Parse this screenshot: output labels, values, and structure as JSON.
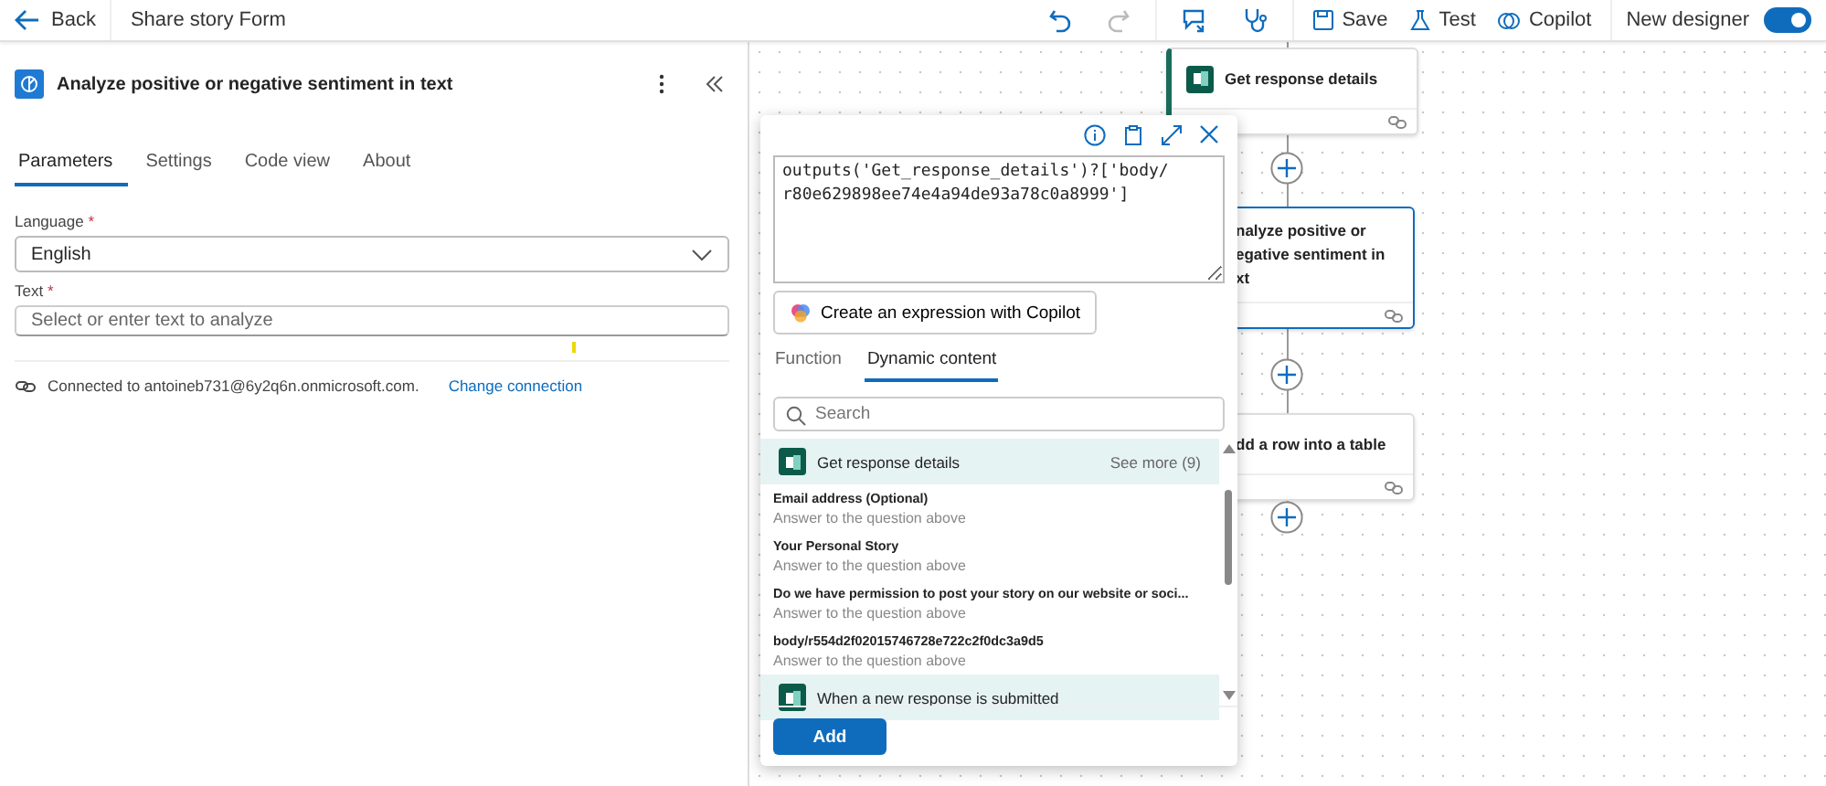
{
  "top_bar": {
    "back": "Back",
    "title": "Share story Form",
    "actions": [
      {
        "kind": "save",
        "label": "Save"
      },
      {
        "kind": "test",
        "label": "Test"
      },
      {
        "kind": "copilot",
        "label": "Copilot"
      }
    ],
    "toggle": {
      "label": "New designer",
      "on": true
    }
  },
  "panel": {
    "title": "Analyze positive or negative sentiment in text",
    "tabs": [
      {
        "label": "Parameters",
        "selected": true
      },
      {
        "label": "Settings",
        "selected": false
      },
      {
        "label": "Code view",
        "selected": false
      },
      {
        "label": "About",
        "selected": false
      }
    ],
    "language": {
      "label": "Language",
      "required": "*",
      "value": "English"
    },
    "text": {
      "label": "Text",
      "required": "*",
      "placeholder": "Select or enter text to analyze"
    },
    "connection": {
      "text": "Connected to antoineb731@6y2q6n.onmicrosoft.com.",
      "link": "Change connection"
    }
  },
  "flow": {
    "nodes": [
      {
        "lines": [
          "Get response details"
        ],
        "covered": false,
        "selected": false
      },
      {
        "lines": [
          "nalyze positive or",
          "egative sentiment in",
          "xt"
        ],
        "covered": true,
        "selected": true
      },
      {
        "lines": [
          "dd a row into a table"
        ],
        "covered": true,
        "selected": false
      }
    ]
  },
  "popup": {
    "expression_lines": [
      "outputs('Get_response_details')?['body/",
      "r80e629898ee74e4a94de93a78c0a8999']"
    ],
    "copilot_button": "Create an expression with Copilot",
    "tabs": [
      {
        "label": "Function",
        "selected": false
      },
      {
        "label": "Dynamic content",
        "selected": true
      }
    ],
    "search": {
      "placeholder": "Search"
    },
    "list": [
      {
        "kind": "group",
        "title": "Get response details",
        "more": "See more (9)"
      },
      {
        "kind": "item",
        "title": "Email address (Optional)",
        "sub": "Answer to the question above"
      },
      {
        "kind": "item",
        "title": "Your Personal Story",
        "sub": "Answer to the question above"
      },
      {
        "kind": "item",
        "title": "Do we have permission to post your story on our website or soci...",
        "sub": "Answer to the question above"
      },
      {
        "kind": "item",
        "title": "body/r554d2f02015746728e722c2f0dc3a9d5",
        "sub": "Answer to the question above"
      },
      {
        "kind": "group",
        "title": "When a new response is submitted"
      }
    ],
    "add_button": "Add"
  }
}
